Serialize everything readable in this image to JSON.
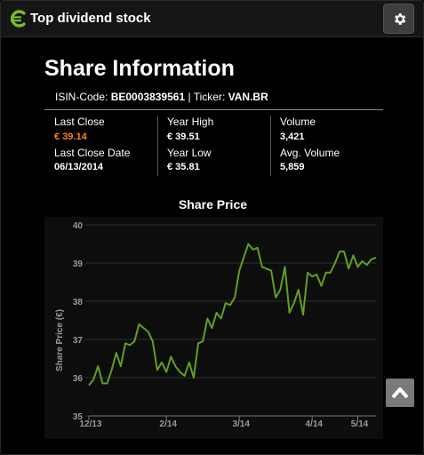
{
  "header": {
    "title": "Top dividend stock",
    "logo_icon": "euro-logo-icon",
    "settings_icon": "gear-icon"
  },
  "page": {
    "title": "Share Information",
    "isin_label": "ISIN-Code:",
    "isin_value": "BE0003839561",
    "separator": "|",
    "ticker_label": "Ticker:",
    "ticker_value": "VAN.BR"
  },
  "stats": {
    "last_close_label": "Last Close",
    "last_close_value": "€ 39.14",
    "last_close_date_label": "Last Close Date",
    "last_close_date_value": "06/13/2014",
    "year_high_label": "Year High",
    "year_high_value": "€ 39.51",
    "year_low_label": "Year Low",
    "year_low_value": "€ 35.81",
    "volume_label": "Volume",
    "volume_value": "3,421",
    "avg_volume_label": "Avg. Volume",
    "avg_volume_value": "5,859"
  },
  "colors": {
    "accent_orange": "#ff7f1f",
    "logo_green": "#6fbf2c",
    "line_green": "#5fa021"
  },
  "chart_data": {
    "type": "line",
    "title": "Share Price",
    "xlabel": "",
    "ylabel": "Share Price (€)",
    "ylim": [
      35,
      40
    ],
    "yticks": [
      35,
      36,
      37,
      38,
      39,
      40
    ],
    "xticks": [
      "12/13",
      "2/14",
      "3/14",
      "4/14",
      "5/14"
    ],
    "grid": true,
    "series": [
      {
        "values": [
          35.8,
          35.95,
          36.3,
          35.85,
          35.85,
          36.2,
          36.65,
          36.3,
          36.9,
          36.85,
          36.95,
          37.4,
          37.3,
          37.2,
          36.95,
          36.2,
          36.4,
          36.15,
          36.55,
          36.3,
          36.15,
          36.05,
          36.4,
          36.0,
          36.9,
          36.95,
          37.55,
          37.3,
          37.7,
          37.55,
          37.95,
          37.9,
          38.1,
          38.8,
          39.15,
          39.5,
          39.35,
          39.4,
          38.9,
          38.85,
          38.8,
          38.1,
          38.3,
          38.9,
          37.7,
          37.95,
          38.3,
          37.65,
          38.75,
          38.65,
          38.7,
          38.4,
          38.75,
          38.75,
          39.0,
          39.3,
          39.3,
          38.85,
          39.2,
          38.9,
          39.05,
          38.95,
          39.1,
          39.14
        ]
      }
    ]
  }
}
